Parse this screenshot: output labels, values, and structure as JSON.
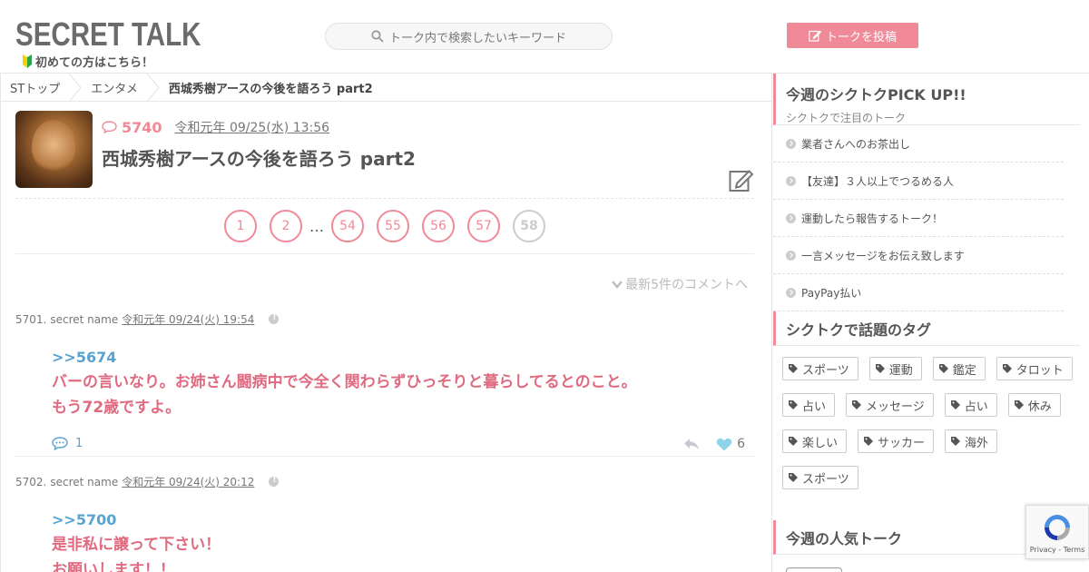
{
  "header": {
    "logo": "SECRET TALK",
    "beginner_link": "初めての方はこちら！",
    "search_placeholder": "トーク内で検索したいキーワード",
    "post_button": "トークを投稿"
  },
  "breadcrumb": [
    "STトップ",
    "エンタメ",
    "西城秀樹アースの今後を語ろう part2"
  ],
  "topic": {
    "count": "5740",
    "date": "令和元年 09/25(水) 13:56",
    "title": "西城秀樹アースの今後を語ろう part2"
  },
  "pagination": {
    "pages": [
      "1",
      "2",
      "54",
      "55",
      "56",
      "57"
    ],
    "ellipsis": "…",
    "current": "58"
  },
  "latest_link": "最新5件のコメントへ",
  "comments": [
    {
      "number": "5701.",
      "name": "secret name",
      "date": "令和元年 09/24(火) 19:54",
      "anchor": ">>5674",
      "body": "バーの言いなり。お姉さん闘病中で今全く関わらずひっそりと暮らしてるとのこと。もう72歳ですよ。",
      "replies": "1",
      "likes": "6"
    },
    {
      "number": "5702.",
      "name": "secret name",
      "date": "令和元年 09/24(火) 20:12",
      "anchor": ">>5700",
      "body_line1": "是非私に譲って下さい！",
      "body_line2": "お願いします！！"
    }
  ],
  "sidebar": {
    "pickup_title": "今週のシクトクPICK UP!!",
    "pickup_subtitle": "シクトクで注目のトーク",
    "pickup_items": [
      "業者さんへのお茶出し",
      "【友達】３人以上でつるめる人",
      "運動したら報告するトーク！",
      "一言メッセージをお伝え致します",
      "PayPay払い"
    ],
    "tags_title": "シクトクで話題のタグ",
    "tags": [
      "スポーツ",
      "運動",
      "鑑定",
      "タロット",
      "占い",
      "メッセージ",
      "占い",
      "休み",
      "楽しい",
      "サッカー",
      "海外",
      "スポーツ"
    ],
    "weekly_title": "今週の人気トーク"
  },
  "recaptcha": {
    "label": "Privacy - Terms"
  },
  "colors": {
    "accent": "#f08a98",
    "anchor": "#5aa3d0",
    "body_text": "#e06b80"
  }
}
